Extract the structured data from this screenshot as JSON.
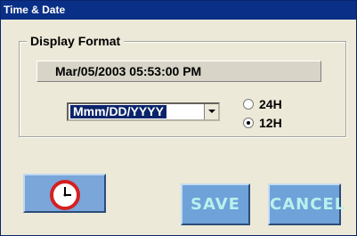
{
  "window": {
    "title": "Time & Date"
  },
  "display_format": {
    "legend": "Display Format",
    "current_datetime": "Mar/05/2003  05:53:00 PM",
    "format_select": {
      "selected": "Mmm/DD/YYYY"
    },
    "clock_mode": {
      "options": [
        {
          "label": "24H",
          "checked": false
        },
        {
          "label": "12H",
          "checked": true
        }
      ]
    }
  },
  "buttons": {
    "clock_icon": "clock-icon",
    "save_label": "SAVE",
    "cancel_label": "CANCEL"
  },
  "colors": {
    "title_bar": "#0a2f86",
    "button_blue": "#6fa2d8",
    "button_text": "#b9f0ee",
    "clock_red": "#d42020"
  }
}
